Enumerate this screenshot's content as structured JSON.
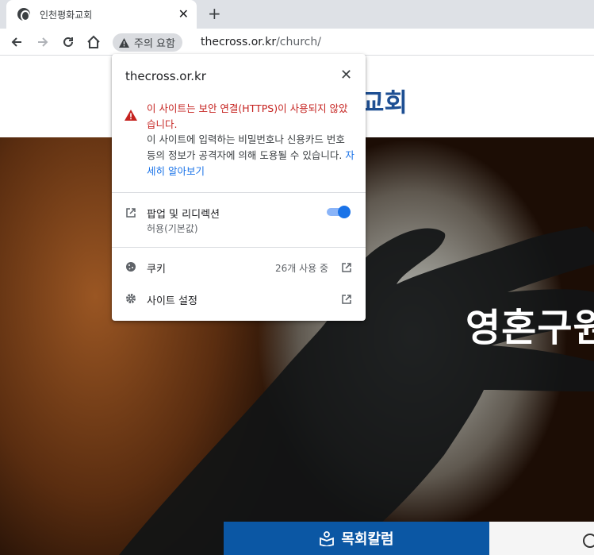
{
  "browser": {
    "tab_title": "인천평화교회",
    "tab_close": "✕",
    "new_tab": "+",
    "security_chip": "주의 요함",
    "url_host": "thecross.or.kr",
    "url_path": "/church/"
  },
  "page": {
    "logo_partial": "교회",
    "hero_text": "영혼구원",
    "quick_link": "목회칼럼"
  },
  "page_info": {
    "host": "thecross.or.kr",
    "close": "✕",
    "warning_title": "이 사이트는 보안 연결(HTTPS)이 사용되지 않았습니다.",
    "warning_body": "이 사이트에 입력하는 비밀번호나 신용카드 번호 등의 정보가 공격자에 의해 도용될 수 있습니다.",
    "learn_more": "자세히 알아보기",
    "popups_label": "팝업 및 리디렉션",
    "popups_sub": "허용(기본값)",
    "popups_enabled": true,
    "cookies_label": "쿠키",
    "cookies_count": "26개 사용 중",
    "site_settings_label": "사이트 설정"
  },
  "colors": {
    "warning": "#c5221f",
    "link": "#1a73e8",
    "logo": "#1e4f93",
    "quick_link_bg": "#0b57a4"
  }
}
